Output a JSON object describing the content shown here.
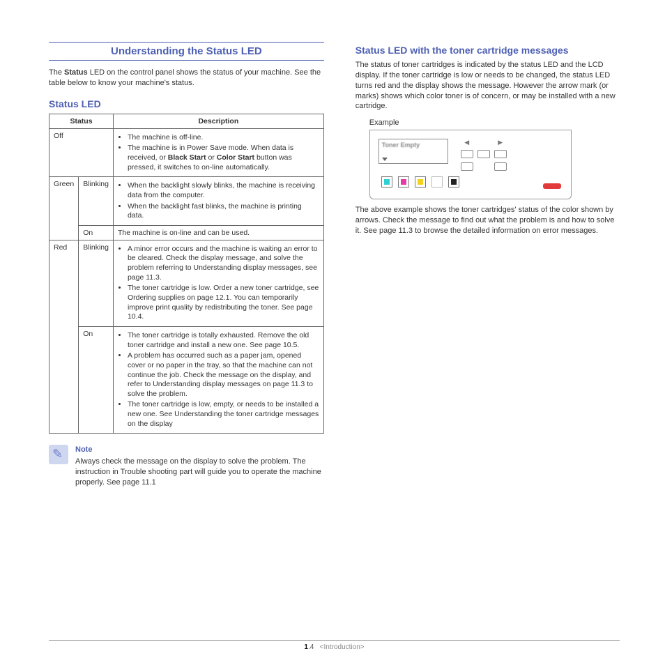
{
  "left": {
    "heading": "Understanding the Status LED",
    "intro_html_pre": "The ",
    "intro_bold": "Status",
    "intro_html_post": " LED on the control panel shows the status of your machine. See the table below to know your machine's status.",
    "sub": "Status LED",
    "th_status": "Status",
    "th_desc": "Description",
    "rows": {
      "off_label": "Off",
      "off_b1": "The machine is off-line.",
      "off_b2_pre": "The machine is in Power Save mode. When data is received, or ",
      "off_b2_bold1": "Black Start",
      "off_b2_mid": " or ",
      "off_b2_bold2": "Color Start",
      "off_b2_post": " button was pressed, it switches to on-line automatically.",
      "green_label": "Green",
      "blink_label": "Blinking",
      "on_label": "On",
      "green_blink_b1": "When the backlight slowly blinks, the machine is receiving data from the computer.",
      "green_blink_b2": "When the backlight fast blinks, the machine is printing data.",
      "green_on": "The machine is on-line and can be used.",
      "red_label": "Red",
      "red_blink_b1": "A minor error occurs and the machine is waiting an error to be cleared. Check the display message, and solve the problem referring to Understanding  display messages, see page 11.3.",
      "red_blink_b2": "The toner cartridge is low. Order a new toner cartridge, see Ordering supplies on page 12.1. You can temporarily improve print quality by redistributing the toner. See page 10.4.",
      "red_on_b1": "The toner cartridge is totally exhausted. Remove the old toner cartridge and install a new one. See page 10.5.",
      "red_on_b2": "A problem has occurred such as a paper jam, opened cover or no paper in the tray, so that the machine can not continue the job. Check the message on the display, and refer to Understanding display messages on page 11.3 to solve the problem.",
      "red_on_b3": "The toner cartridge is low, empty, or needs to be installed a new one. See Understanding the toner cartridge messages on the display"
    },
    "note_title": "Note",
    "note_text": "Always check the message on the display to solve the problem. The instruction in Trouble shooting part will guide you to operate the machine properly. See page 11.1"
  },
  "right": {
    "heading": "Status LED with the toner cartridge messages",
    "p1": "The status of toner cartridges is indicated by the status LED and the LCD display. If the toner cartridge is low or needs to be changed, the status LED turns red and the display shows the message. However the arrow mark (or marks) shows which color toner is of concern, or may be installed with a new cartridge.",
    "example_label": "Example",
    "lcd_text": "Toner Empty",
    "p2": "The above example shows the toner cartridges' status of the color shown by arrows. Check the message to find out what the problem is and how to solve it. See page 11.3 to browse the detailed information on error messages."
  },
  "footer": {
    "page_major": "1",
    "page_minor": ".4",
    "section": "<Introduction>"
  }
}
